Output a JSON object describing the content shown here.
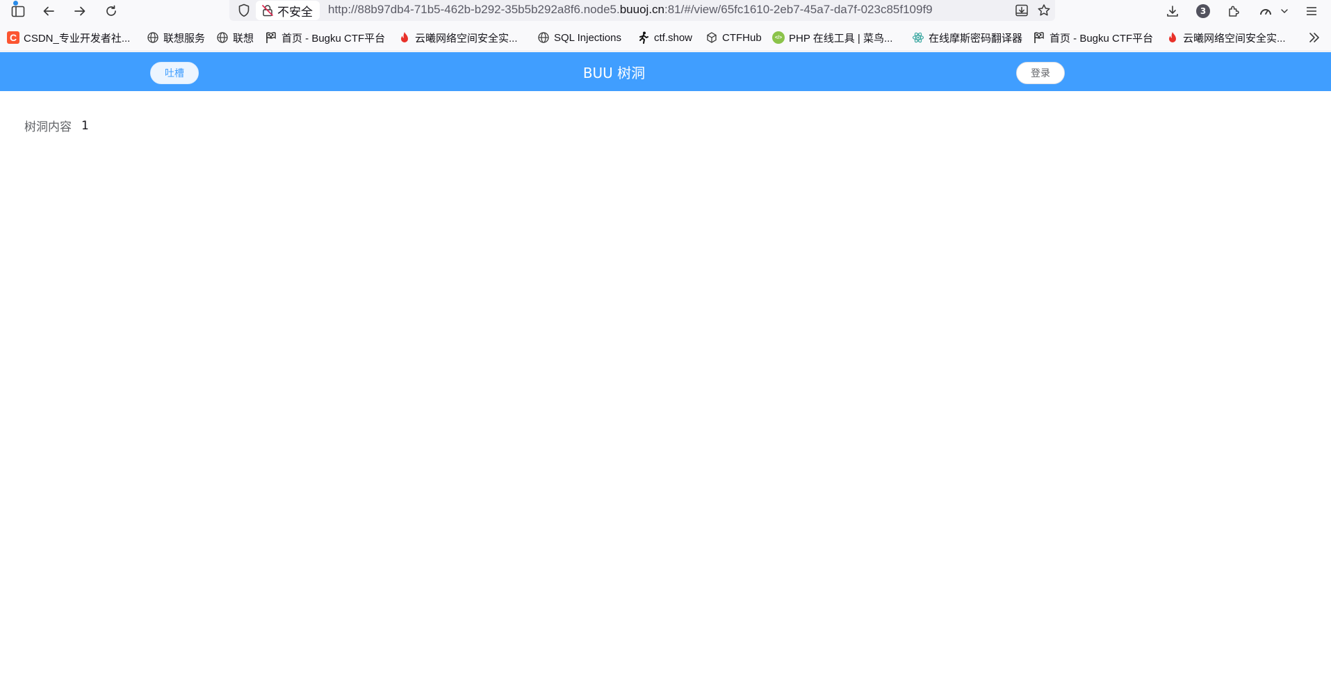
{
  "browser": {
    "tab_badge_count": "3",
    "security_label": "不安全",
    "url_prefix": "http://88b97db4-71b5-462b-b292-35b5b292a8f6.node5.",
    "url_host": "buuoj.cn",
    "url_suffix": ":81/#/view/65fc1610-2eb7-45a7-da7f-023c85f109f9"
  },
  "bookmarks": [
    {
      "label": "CSDN_专业开发者社...",
      "icon": "csdn-icon"
    },
    {
      "label": "联想服务",
      "icon": "globe-icon"
    },
    {
      "label": "联想",
      "icon": "globe-icon"
    },
    {
      "label": "首页 - Bugku CTF平台",
      "icon": "flag-icon"
    },
    {
      "label": "云曦网络空间安全实...",
      "icon": "fire-icon"
    },
    {
      "label": "SQL Injections",
      "icon": "globe-icon"
    },
    {
      "label": "ctf.show",
      "icon": "runner-icon"
    },
    {
      "label": "CTFHub",
      "icon": "cube-icon"
    },
    {
      "label": "PHP 在线工具 | 菜鸟...",
      "icon": "php-icon"
    },
    {
      "label": "在线摩斯密码翻译器",
      "icon": "atom-icon"
    },
    {
      "label": "首页 - Bugku CTF平台",
      "icon": "flag-icon"
    },
    {
      "label": "云曦网络空间安全实...",
      "icon": "fire-icon"
    }
  ],
  "header": {
    "tucao_label": "吐槽",
    "title": "BUU 树洞",
    "login_label": "登录"
  },
  "content": {
    "label": "树洞内容",
    "value": "1"
  },
  "colors": {
    "header_bg": "#409eff",
    "csdn_red": "#fc5531",
    "fire_red": "#e8312a"
  }
}
